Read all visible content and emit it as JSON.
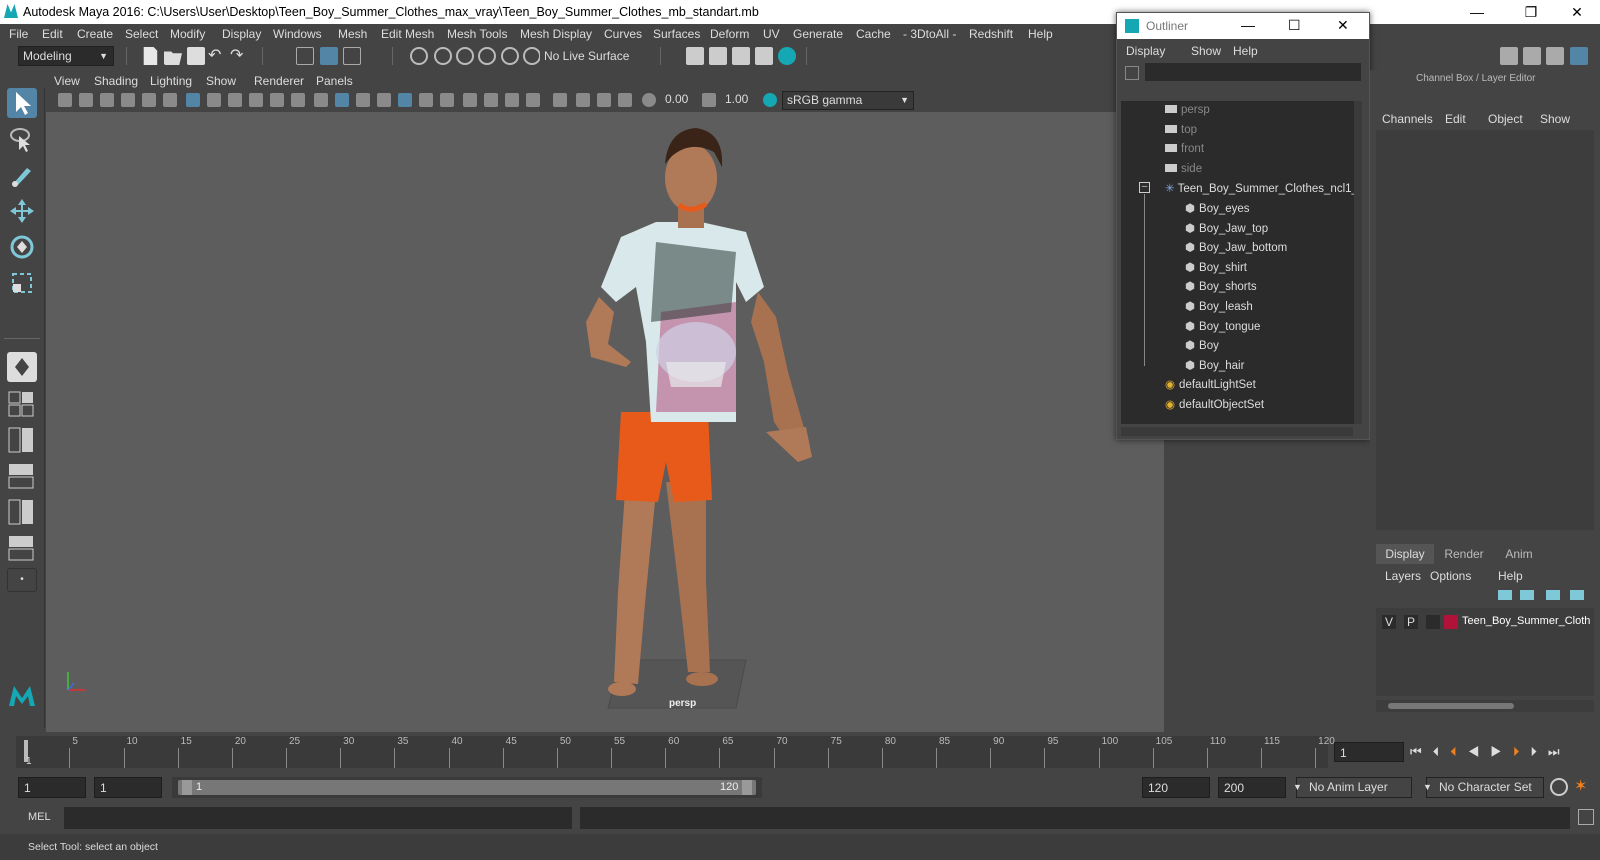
{
  "window": {
    "title": "Autodesk Maya 2016: C:\\Users\\User\\Desktop\\Teen_Boy_Summer_Clothes_max_vray\\Teen_Boy_Summer_Clothes_mb_standart.mb",
    "minimize": "—",
    "restore": "❐",
    "close": "✕"
  },
  "menubar": [
    "File",
    "Edit",
    "Create",
    "Select",
    "Modify",
    "Display",
    "Windows",
    "Mesh",
    "Edit Mesh",
    "Mesh Tools",
    "Mesh Display",
    "Curves",
    "Surfaces",
    "Deform",
    "UV",
    "Generate",
    "Cache",
    "- 3DtoAll -",
    "Redshift",
    "Help"
  ],
  "statusline": {
    "mode": "Modeling",
    "live_surface": "No Live Surface"
  },
  "viewport": {
    "menus": [
      "View",
      "Shading",
      "Lighting",
      "Show",
      "Renderer",
      "Panels"
    ],
    "exposure": "0.00",
    "gamma": "1.00",
    "color_space": "sRGB gamma",
    "camera_label": "persp"
  },
  "outliner": {
    "title": "Outliner",
    "menus": [
      "Display",
      "Show",
      "Help"
    ],
    "items": [
      {
        "label": "persp",
        "type": "camera",
        "indent": 0
      },
      {
        "label": "top",
        "type": "camera",
        "indent": 0
      },
      {
        "label": "front",
        "type": "camera",
        "indent": 0
      },
      {
        "label": "side",
        "type": "camera",
        "indent": 0
      },
      {
        "label": "Teen_Boy_Summer_Clothes_ncl1_",
        "type": "group",
        "indent": 0
      },
      {
        "label": "Boy_eyes",
        "type": "mesh",
        "indent": 1
      },
      {
        "label": "Boy_Jaw_top",
        "type": "mesh",
        "indent": 1
      },
      {
        "label": "Boy_Jaw_bottom",
        "type": "mesh",
        "indent": 1
      },
      {
        "label": "Boy_shirt",
        "type": "mesh",
        "indent": 1
      },
      {
        "label": "Boy_shorts",
        "type": "mesh",
        "indent": 1
      },
      {
        "label": "Boy_leash",
        "type": "mesh",
        "indent": 1
      },
      {
        "label": "Boy_tongue",
        "type": "mesh",
        "indent": 1
      },
      {
        "label": "Boy",
        "type": "mesh",
        "indent": 1
      },
      {
        "label": "Boy_hair",
        "type": "mesh",
        "indent": 1
      },
      {
        "label": "defaultLightSet",
        "type": "set",
        "indent": 0
      },
      {
        "label": "defaultObjectSet",
        "type": "set",
        "indent": 0
      }
    ]
  },
  "channelbox": {
    "header": "Channel Box / Layer Editor",
    "menus": [
      "Channels",
      "Edit",
      "Object",
      "Show"
    ],
    "tabs": [
      "Display",
      "Render",
      "Anim"
    ],
    "layer_menus": [
      "Layers",
      "Options",
      "Help"
    ],
    "layer": {
      "v": "V",
      "p": "P",
      "name": "Teen_Boy_Summer_Cloth",
      "color": "#b0123a"
    }
  },
  "timeline": {
    "first_tick": "1",
    "ticks": [
      "5",
      "10",
      "15",
      "20",
      "25",
      "30",
      "35",
      "40",
      "45",
      "50",
      "55",
      "60",
      "65",
      "70",
      "75",
      "80",
      "85",
      "90",
      "95",
      "100",
      "105",
      "110",
      "115",
      "120"
    ],
    "current_frame": "1"
  },
  "range": {
    "start": "1",
    "playback_start": "1",
    "slider_start": "1",
    "slider_end": "120",
    "playback_end": "120",
    "end": "200",
    "anim_layer": "No Anim Layer",
    "character_set": "No Character Set"
  },
  "mel": {
    "label": "MEL"
  },
  "helpline": "Select Tool: select an object",
  "colors": {
    "accent": "#5285a6",
    "maya_teal": "#16a7b5",
    "shirt": "#d9e8ea",
    "shorts": "#e85a1a",
    "skin": "#b07a58"
  }
}
